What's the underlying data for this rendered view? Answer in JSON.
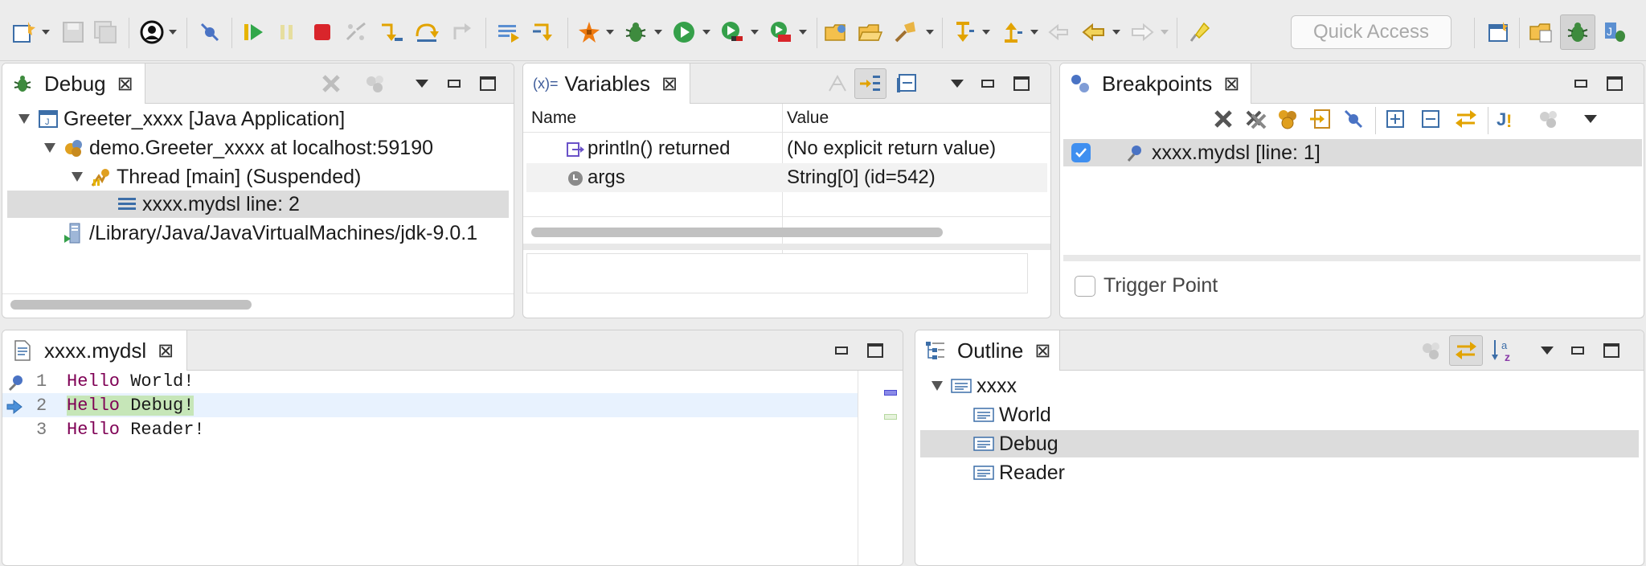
{
  "toolbar": {
    "quick_access_placeholder": "Quick Access"
  },
  "debug_view": {
    "tab_label": "Debug",
    "tree": [
      {
        "label": "Greeter_xxxx [Java Application]"
      },
      {
        "label": "demo.Greeter_xxxx at localhost:59190"
      },
      {
        "label": "Thread [main] (Suspended)"
      },
      {
        "label": "xxxx.mydsl line: 2"
      },
      {
        "label": "/Library/Java/JavaVirtualMachines/jdk-9.0.1"
      }
    ]
  },
  "variables_view": {
    "tab_label": "Variables",
    "tab_prefix": "(x)=",
    "columns": [
      "Name",
      "Value"
    ],
    "rows": [
      {
        "name": "println() returned",
        "value": "(No explicit return value)"
      },
      {
        "name": "args",
        "value": "String[0]  (id=542)"
      }
    ]
  },
  "breakpoints_view": {
    "tab_label": "Breakpoints",
    "items": [
      {
        "label": "xxxx.mydsl [line: 1]",
        "checked": true
      }
    ],
    "trigger_point_label": "Trigger Point"
  },
  "editor": {
    "tab_label": "xxxx.mydsl",
    "lines": [
      {
        "number": "1",
        "keyword": "Hello",
        "rest": " World!"
      },
      {
        "number": "2",
        "keyword": "Hello",
        "rest": " Debug!"
      },
      {
        "number": "3",
        "keyword": "Hello",
        "rest": " Reader!"
      }
    ]
  },
  "outline_view": {
    "tab_label": "Outline",
    "root": "xxxx",
    "children": [
      "World",
      "Debug",
      "Reader"
    ]
  },
  "colors": {
    "keyword": "#7f0055",
    "current_line": "#e8f2fe",
    "current_highlight": "#c6e6b8",
    "selection": "#dcdcdc"
  }
}
